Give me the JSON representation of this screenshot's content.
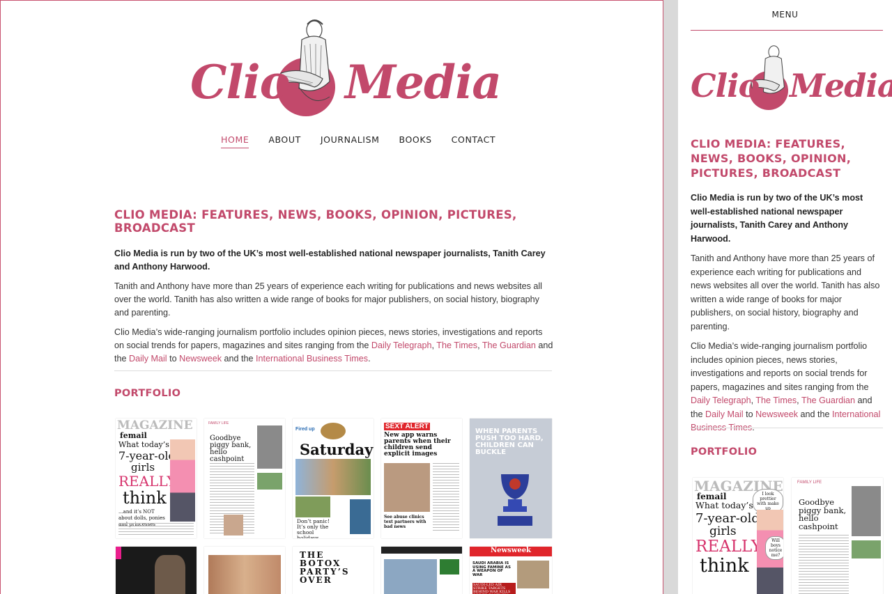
{
  "brand": {
    "name_part1": "Clio",
    "name_part2": "Media"
  },
  "nav": {
    "items": [
      {
        "label": "HOME",
        "active": true
      },
      {
        "label": "ABOUT"
      },
      {
        "label": "JOURNALISM"
      },
      {
        "label": "BOOKS"
      },
      {
        "label": "CONTACT"
      }
    ],
    "menu_label": "MENU"
  },
  "content": {
    "heading": "CLIO MEDIA: FEATURES, NEWS, BOOKS, OPINION, PICTURES, BROADCAST",
    "intro_bold": "Clio Media is run by two of the UK’s most well-established national newspaper journalists, Tanith Carey and Anthony Harwood.",
    "para2": "Tanith and Anthony have more than 25 years of experience each writing for publications and news websites all over the world. Tanith has also written a wide range of books for major publishers, on social history, biography and parenting.",
    "para3_start": "Clio Media’s wide-ranging journalism portfolio includes opinion pieces, news stories, investigations and reports on social trends for papers, magazines and sites ranging from the ",
    "links": {
      "telegraph": "Daily Telegraph",
      "times": "The Times",
      "guardian": "The Guardian",
      "mail": "Daily Mail",
      "newsweek": "Newsweek",
      "ibt": "International Business Times"
    },
    "sep1": ", ",
    "sep2": ", ",
    "and_the": " and the ",
    "to": " to ",
    "and_the2": " and the ",
    "end": ".",
    "portfolio_heading": "PORTFOLIO"
  },
  "thumbs": {
    "femail": {
      "mag": "MAGAZINE",
      "brand": "femail",
      "l1": "What today’s",
      "l2": "7-year-old",
      "l3": "girls",
      "l4": "REALLY",
      "l5": "think",
      "l6": "...and it’s NOT about dolls, ponies and princesses"
    },
    "piggy": {
      "tag": "FAMILY LIFE",
      "title": "Goodbye piggy bank, hello cashpoint"
    },
    "saturday": {
      "kicker": "Fired up",
      "title": "Saturday",
      "sub": "Don’t panic! It’s only the school holidays..."
    },
    "sext": {
      "badge": "SEXT ALERT",
      "title": "New app warns parents when their children send explicit images",
      "sub": "See abuse clinics text partners with bad news"
    },
    "parents": {
      "title": "WHEN PARENTS PUSH TOO HARD, CHILDREN CAN BUCKLE"
    },
    "botox": {
      "title": "THE BOTOX PARTY’S OVER"
    },
    "newsweek": {
      "mast": "Newsweek",
      "title": "SAUDI ARABIA IS USING FAMINE AS A WEAPON OF WAR",
      "sub": "SAUDI-LED AIR STRIKE TARGETS BEHIND WAR KILLS DRIVER IN YEMEN"
    },
    "mobile_femail": {
      "bubble": "I look prettier with make up",
      "bubble2": "Will boys notice me?"
    }
  },
  "colors": {
    "accent": "#c2496b",
    "text": "#333333",
    "panel_bg": "#d9d9d9"
  }
}
